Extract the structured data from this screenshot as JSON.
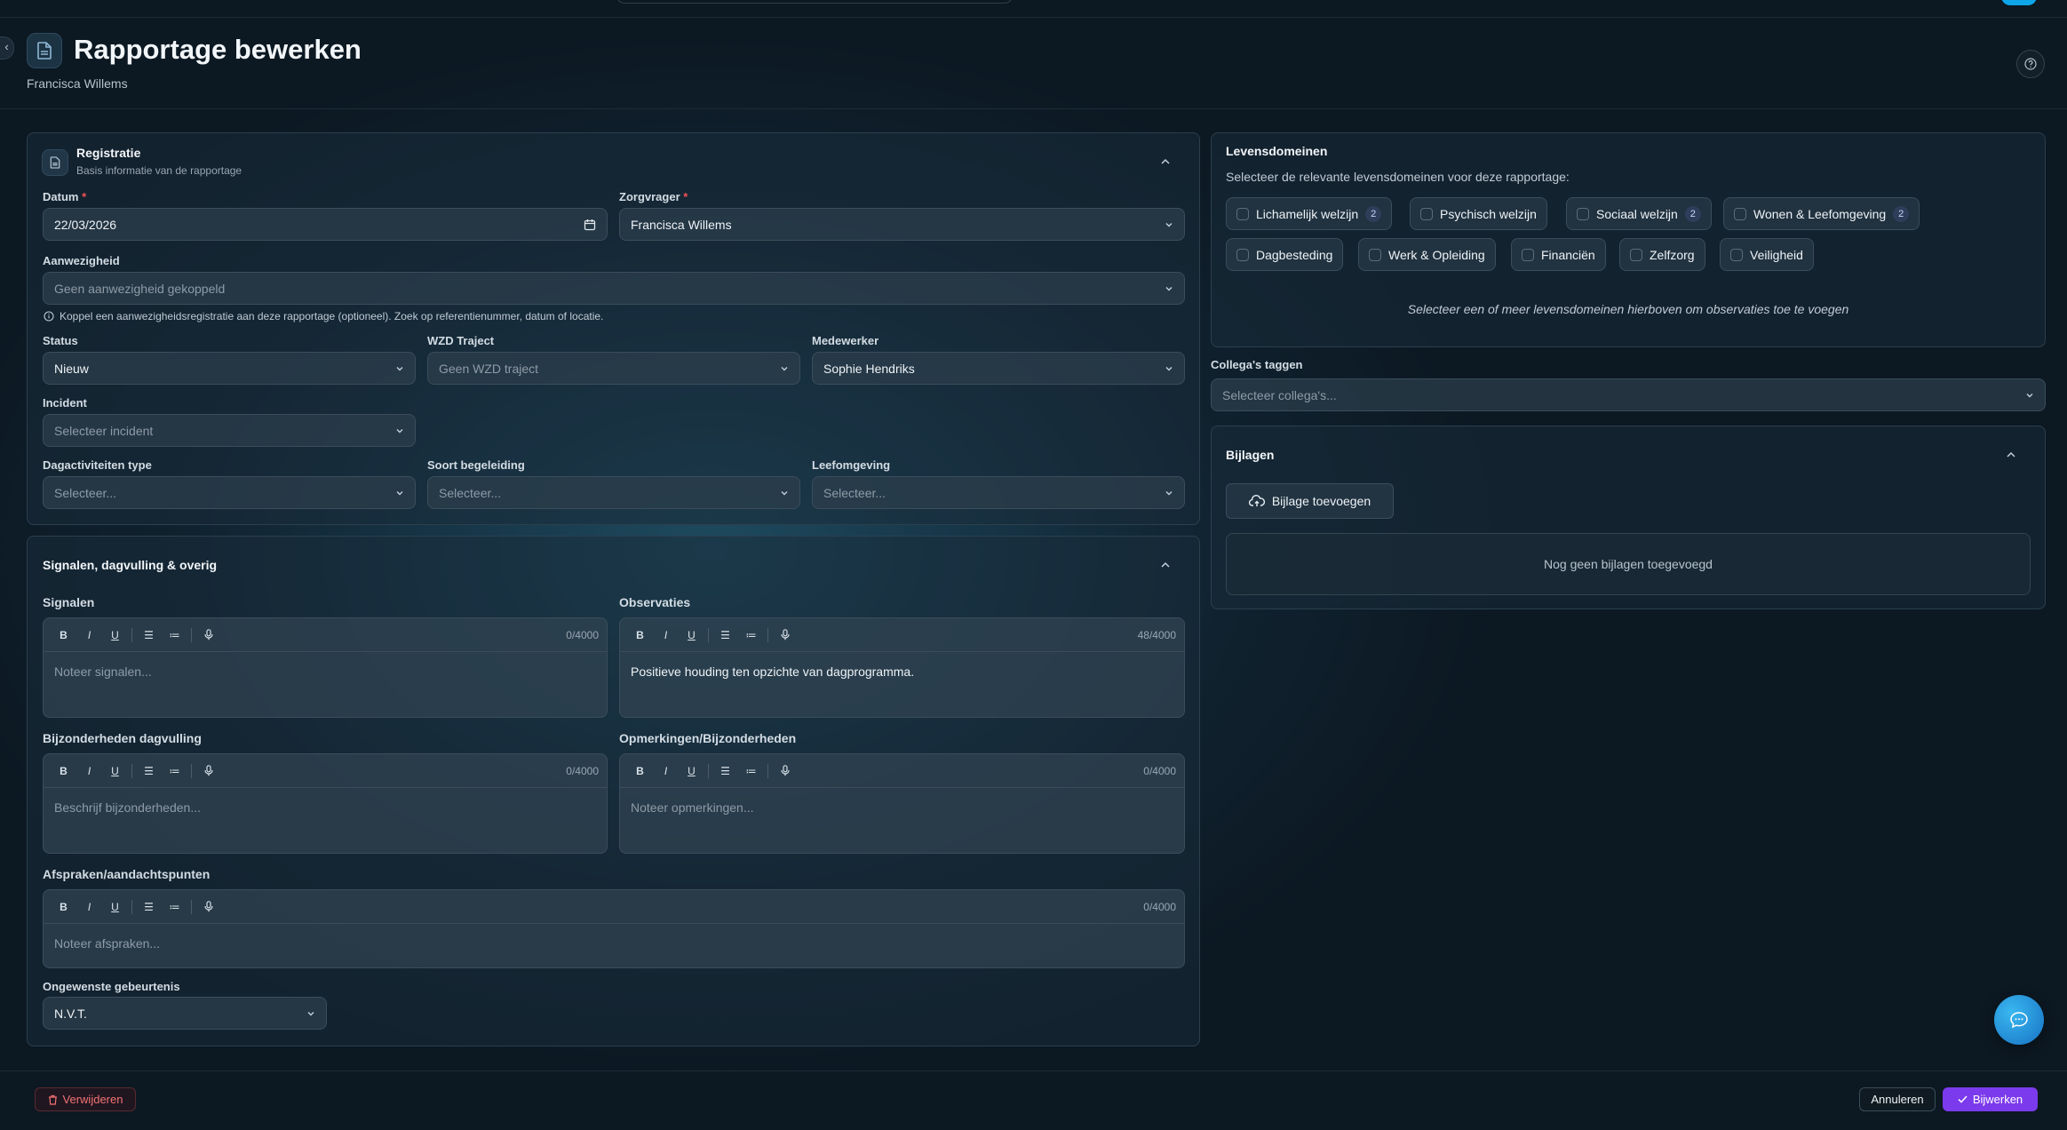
{
  "header": {
    "title": "Rapportage bewerken",
    "subtitle": "Francisca Willems"
  },
  "registratie": {
    "title": "Registratie",
    "subtitle": "Basis informatie van de rapportage",
    "datum": {
      "label": "Datum",
      "value": "22/03/2026"
    },
    "zorgvrager": {
      "label": "Zorgvrager",
      "value": "Francisca Willems"
    },
    "aanwezigheid": {
      "label": "Aanwezigheid",
      "placeholder": "Geen aanwezigheid gekoppeld",
      "hint": "Koppel een aanwezigheidsregistratie aan deze rapportage (optioneel). Zoek op referentienummer, datum of locatie."
    },
    "status": {
      "label": "Status",
      "value": "Nieuw"
    },
    "wzd": {
      "label": "WZD Traject",
      "placeholder": "Geen WZD traject"
    },
    "medewerker": {
      "label": "Medewerker",
      "value": "Sophie Hendriks"
    },
    "incident": {
      "label": "Incident",
      "placeholder": "Selecteer incident"
    },
    "dagactiviteiten": {
      "label": "Dagactiviteiten type",
      "placeholder": "Selecteer..."
    },
    "begeleiding": {
      "label": "Soort begeleiding",
      "placeholder": "Selecteer..."
    },
    "leefomgeving": {
      "label": "Leefomgeving",
      "placeholder": "Selecteer..."
    }
  },
  "signalen": {
    "title": "Signalen, dagvulling & overig",
    "toolbar": {
      "bold": "B",
      "italic": "I",
      "underline": "U"
    },
    "fields": {
      "signalen": {
        "label": "Signalen",
        "counter": "0/4000",
        "placeholder": "Noteer signalen..."
      },
      "observaties": {
        "label": "Observaties",
        "counter": "48/4000",
        "value": "Positieve houding ten opzichte van dagprogramma."
      },
      "dagvulling": {
        "label": "Bijzonderheden dagvulling",
        "counter": "0/4000",
        "placeholder": "Beschrijf bijzonderheden..."
      },
      "opmerkingen": {
        "label": "Opmerkingen/Bijzonderheden",
        "counter": "0/4000",
        "placeholder": "Noteer opmerkingen..."
      },
      "afspraken": {
        "label": "Afspraken/aandachtspunten",
        "counter": "0/4000",
        "placeholder": "Noteer afspraken..."
      }
    },
    "ongewenst": {
      "label": "Ongewenste gebeurtenis",
      "value": "N.V.T."
    }
  },
  "levensdomeinen": {
    "title": "Levensdomeinen",
    "subtitle": "Selecteer de relevante levensdomeinen voor deze rapportage:",
    "chips": [
      {
        "label": "Lichamelijk welzijn",
        "count": "2"
      },
      {
        "label": "Psychisch welzijn",
        "count": ""
      },
      {
        "label": "Sociaal welzijn",
        "count": "2"
      },
      {
        "label": "Wonen & Leefomgeving",
        "count": "2"
      },
      {
        "label": "Dagbesteding",
        "count": ""
      },
      {
        "label": "Werk & Opleiding",
        "count": ""
      },
      {
        "label": "Financiën",
        "count": ""
      },
      {
        "label": "Zelfzorg",
        "count": ""
      },
      {
        "label": "Veiligheid",
        "count": ""
      }
    ],
    "empty_note": "Selecteer een of meer levensdomeinen hierboven om observaties toe te voegen"
  },
  "collegas": {
    "label": "Collega's taggen",
    "placeholder": "Selecteer collega's..."
  },
  "bijlagen": {
    "title": "Bijlagen",
    "add_label": "Bijlage toevoegen",
    "empty": "Nog geen bijlagen toegevoegd"
  },
  "footer": {
    "delete_label": "Verwijderen",
    "cancel_label": "Annuleren",
    "submit_label": "Bijwerken"
  },
  "colors": {
    "accent": "#7c3aed",
    "danger": "#f05252",
    "chat": "#1e90d8"
  }
}
